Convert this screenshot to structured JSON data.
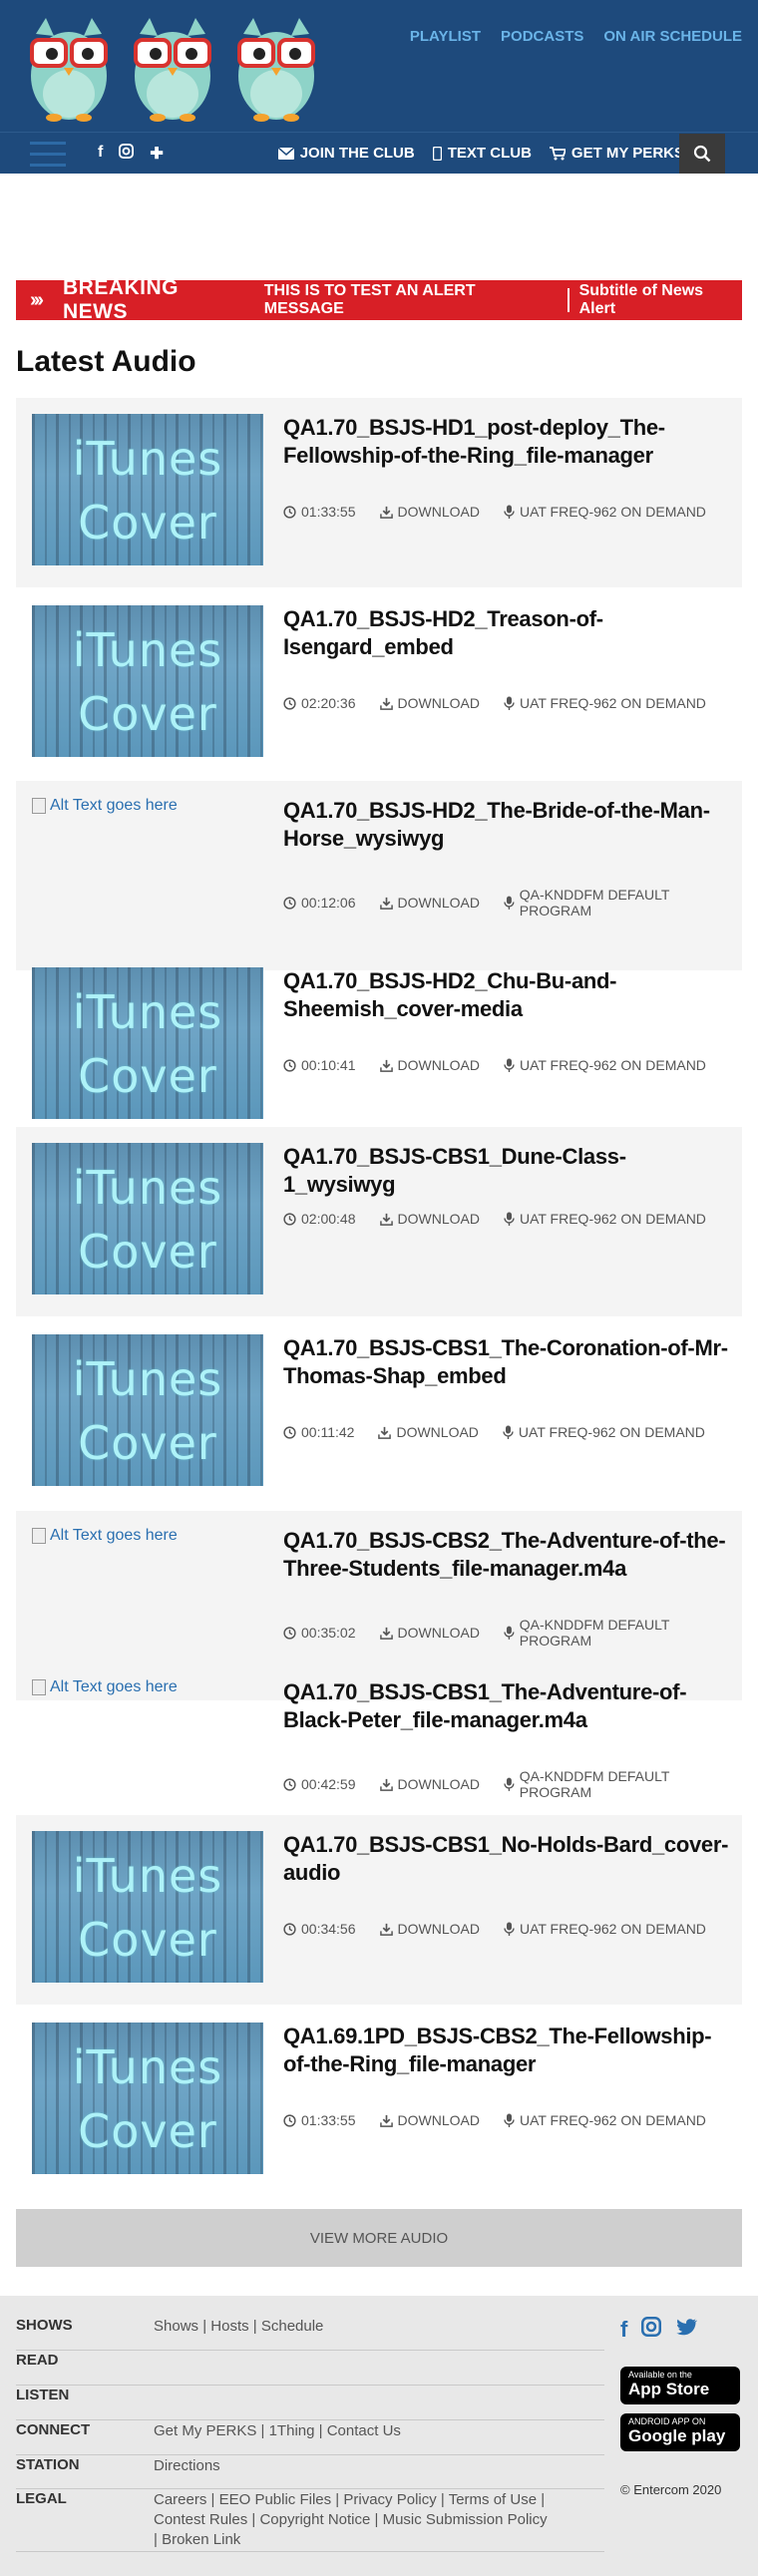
{
  "header": {
    "top_nav": [
      "PLAYLIST",
      "PODCASTS",
      "ON AIR SCHEDULE"
    ],
    "secondary_nav": [
      "JOIN THE CLUB",
      "TEXT CLUB",
      "GET MY PERKS"
    ],
    "colors": {
      "header_bg": "#1e4a7c",
      "nav_link": "#6ab4e8",
      "breaking": "#d81f26"
    }
  },
  "breaking": {
    "label": "BREAKING NEWS",
    "message": "THIS IS TO TEST AN ALERT MESSAGE",
    "subtitle": "Subtitle of News Alert"
  },
  "section_title": "Latest Audio",
  "thumb_text": {
    "line1": "iTunes",
    "line2": "Cover"
  },
  "alt_text": "Alt Text goes here",
  "download_label": "DOWNLOAD",
  "items": [
    {
      "title": "QA1.70_BSJS-HD1_post-deploy_The-Fellowship-of-the-Ring_file-manager",
      "duration": "01:33:55",
      "program": "UAT FREQ-962 ON DEMAND",
      "image": "itunes"
    },
    {
      "title": "QA1.70_BSJS-HD2_Treason-of-Isengard_embed",
      "duration": "02:20:36",
      "program": "UAT FREQ-962 ON DEMAND",
      "image": "itunes"
    },
    {
      "title": "QA1.70_BSJS-HD2_The-Bride-of-the-Man-Horse_wysiwyg",
      "duration": "00:12:06",
      "program": "QA-KNDDFM DEFAULT PROGRAM",
      "image": "alt"
    },
    {
      "title": "QA1.70_BSJS-HD2_Chu-Bu-and-Sheemish_cover-media",
      "duration": "00:10:41",
      "program": "UAT FREQ-962 ON DEMAND",
      "image": "itunes"
    },
    {
      "title": "QA1.70_BSJS-CBS1_Dune-Class-1_wysiwyg",
      "duration": "02:00:48",
      "program": "UAT FREQ-962 ON DEMAND",
      "image": "itunes"
    },
    {
      "title": "QA1.70_BSJS-CBS1_The-Coronation-of-Mr-Thomas-Shap_embed",
      "duration": "00:11:42",
      "program": "UAT FREQ-962 ON DEMAND",
      "image": "itunes"
    },
    {
      "title": "QA1.70_BSJS-CBS2_The-Adventure-of-the-Three-Students_file-manager.m4a",
      "duration": "00:35:02",
      "program": "QA-KNDDFM DEFAULT PROGRAM",
      "image": "alt"
    },
    {
      "title": "QA1.70_BSJS-CBS1_The-Adventure-of-Black-Peter_file-manager.m4a",
      "duration": "00:42:59",
      "program": "QA-KNDDFM DEFAULT PROGRAM",
      "image": "alt"
    },
    {
      "title": "QA1.70_BSJS-CBS1_No-Holds-Bard_cover-audio",
      "duration": "00:34:56",
      "program": "UAT FREQ-962 ON DEMAND",
      "image": "itunes"
    },
    {
      "title": "QA1.69.1PD_BSJS-CBS2_The-Fellowship-of-the-Ring_file-manager",
      "duration": "01:33:55",
      "program": "UAT FREQ-962 ON DEMAND",
      "image": "itunes"
    }
  ],
  "view_more": "VIEW MORE AUDIO",
  "footer": {
    "rows": [
      {
        "key": "SHOWS",
        "links": [
          "Shows",
          "Hosts",
          "Schedule"
        ]
      },
      {
        "key": "READ",
        "links": []
      },
      {
        "key": "LISTEN",
        "links": []
      },
      {
        "key": "CONNECT",
        "links": [
          "Get My PERKS",
          "1Thing",
          "Contact Us"
        ]
      },
      {
        "key": "STATION",
        "links": [
          "Directions"
        ]
      },
      {
        "key": "LEGAL",
        "links": [
          "Careers",
          "EEO Public Files",
          "Privacy Policy",
          "Terms of Use",
          "Contest Rules",
          "Copyright Notice",
          "Music Submission Policy",
          "Broken Link"
        ]
      }
    ],
    "app_store": {
      "small": "Available on the",
      "big": "App Store"
    },
    "google_play": {
      "small": "ANDROID APP ON",
      "big": "Google play"
    },
    "copyright": "© Entercom 2020"
  }
}
